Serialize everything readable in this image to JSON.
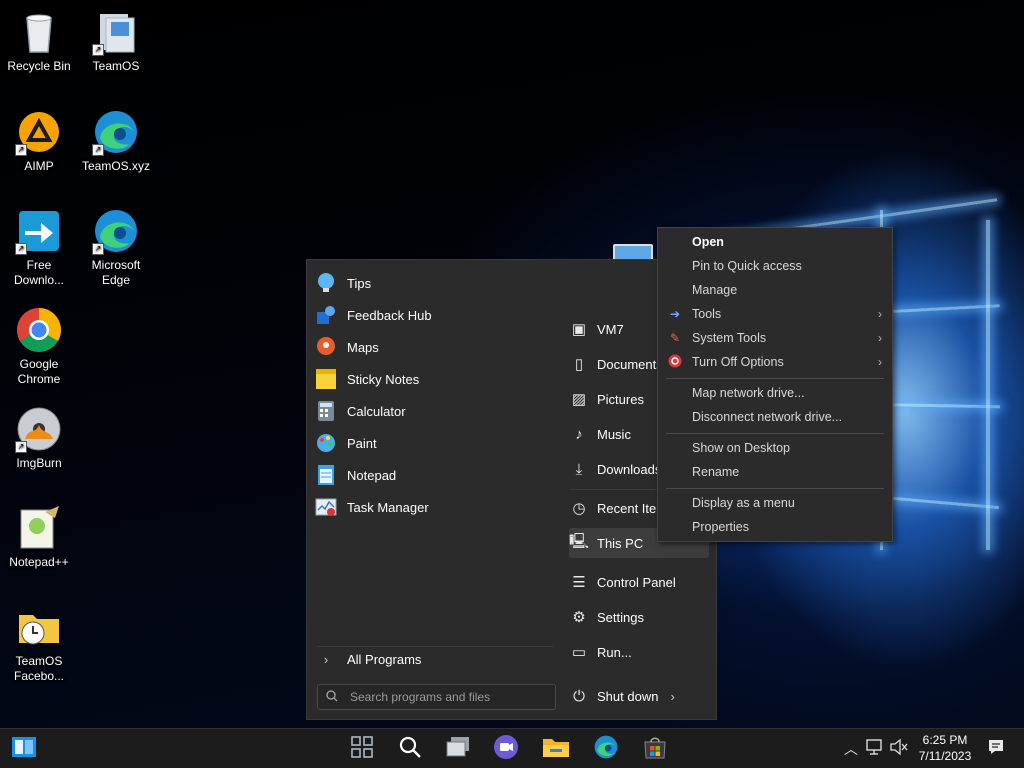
{
  "desktop": {
    "icons": [
      {
        "label": "Recycle Bin",
        "icon": "recycle-bin-icon"
      },
      {
        "label": "TeamOS",
        "icon": "teamos-shortcut-icon"
      },
      {
        "label": "AIMP",
        "icon": "aimp-icon"
      },
      {
        "label": "TeamOS.xyz",
        "icon": "edge-icon"
      },
      {
        "label": "Free Downlo...",
        "icon": "free-download-manager-icon"
      },
      {
        "label": "Microsoft Edge",
        "icon": "edge-icon"
      },
      {
        "label": "Google Chrome",
        "icon": "chrome-icon"
      },
      {
        "label": "ImgBurn",
        "icon": "imgburn-icon"
      },
      {
        "label": "Notepad++",
        "icon": "notepadpp-icon"
      },
      {
        "label": "TeamOS Facebo...",
        "icon": "folder-clock-icon"
      }
    ]
  },
  "start_menu": {
    "programs": [
      {
        "label": "Tips",
        "icon": "tips-icon"
      },
      {
        "label": "Feedback Hub",
        "icon": "feedback-hub-icon"
      },
      {
        "label": "Maps",
        "icon": "maps-icon"
      },
      {
        "label": "Sticky Notes",
        "icon": "sticky-notes-icon"
      },
      {
        "label": "Calculator",
        "icon": "calculator-icon"
      },
      {
        "label": "Paint",
        "icon": "paint-icon"
      },
      {
        "label": "Notepad",
        "icon": "notepad-icon"
      },
      {
        "label": "Task Manager",
        "icon": "task-manager-icon"
      }
    ],
    "all_programs": "All Programs",
    "search_placeholder": "Search programs and files",
    "places": [
      {
        "label": "VM7",
        "icon": "user-folder-icon"
      },
      {
        "label": "Documents",
        "icon": "document-icon"
      },
      {
        "label": "Pictures",
        "icon": "pictures-icon"
      },
      {
        "label": "Music",
        "icon": "music-icon"
      },
      {
        "label": "Downloads",
        "icon": "download-icon"
      },
      {
        "label": "Recent Items",
        "icon": "clock-icon"
      },
      {
        "label": "This PC",
        "icon": "computer-icon"
      },
      {
        "label": "Control Panel",
        "icon": "control-panel-icon"
      },
      {
        "label": "Settings",
        "icon": "gear-icon"
      },
      {
        "label": "Run...",
        "icon": "run-icon"
      }
    ],
    "shutdown_label": "Shut down"
  },
  "context_menu": {
    "items": [
      {
        "label": "Open",
        "bold": true
      },
      {
        "label": "Pin to Quick access"
      },
      {
        "label": "Manage"
      },
      {
        "label": "Tools",
        "icon": "tools-arrow-icon",
        "submenu": true
      },
      {
        "label": "System Tools",
        "icon": "system-tools-icon",
        "submenu": true
      },
      {
        "label": "Turn Off Options",
        "icon": "power-icon",
        "submenu": true
      },
      {
        "label": "Map network drive..."
      },
      {
        "label": "Disconnect network drive..."
      },
      {
        "label": "Show on Desktop"
      },
      {
        "label": "Rename"
      },
      {
        "label": "Display as a menu"
      },
      {
        "label": "Properties"
      }
    ]
  },
  "taskbar": {
    "time": "6:25 PM",
    "date": "7/11/2023",
    "apps": [
      "start-icon",
      "task-view-icon",
      "search-icon",
      "window-icon",
      "teams-icon",
      "file-explorer-icon",
      "edge-icon",
      "store-icon"
    ],
    "tray": [
      "chevron-up-icon",
      "network-icon",
      "volume-icon",
      "notification-icon"
    ]
  },
  "colors": {
    "menu_bg": "#2b2b2b",
    "taskbar_bg": "#1c1c1c",
    "accent": "#0078d4"
  }
}
